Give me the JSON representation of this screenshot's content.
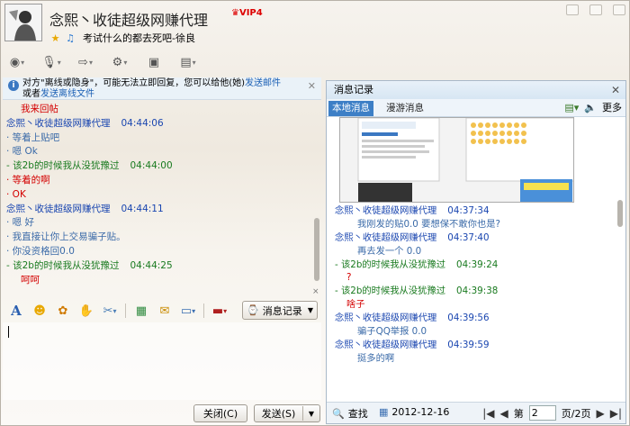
{
  "header": {
    "title": "念熙丶收徒超级网赚代理",
    "vip": "VIP4",
    "signature": "考试什么的都去死吧-徐良"
  },
  "notice": {
    "text": "对方\"离线或隐身\"，可能无法立即回复，您可以给他(她)",
    "link1": "发送邮件",
    "middle": "或者",
    "link2": "发送离线文件"
  },
  "chat": [
    {
      "text": "我来回帖",
      "style": "red",
      "indent": true
    },
    {
      "text": "念熙丶收徒超级网赚代理",
      "time": "04:44:06",
      "style": "blue"
    },
    {
      "text": "· 等着上贴吧",
      "style": "msg"
    },
    {
      "text": "· 嗯 Ok",
      "style": "msg"
    },
    {
      "text": "- 该2b的时候我从没犹豫过",
      "time": "04:44:00",
      "style": "green"
    },
    {
      "text": "· 等着的啊",
      "style": "red"
    },
    {
      "text": "· OK",
      "style": "red"
    },
    {
      "text": "念熙丶收徒超级网赚代理",
      "time": "04:44:11",
      "style": "blue"
    },
    {
      "text": "· 嗯 好",
      "style": "msg"
    },
    {
      "text": "· 我直接让你上交易骗子贴。",
      "style": "msg"
    },
    {
      "text": "·   你没资格回0.0",
      "style": "msg"
    },
    {
      "text": "- 该2b的时候我从没犹豫过",
      "time": "04:44:25",
      "style": "green"
    },
    {
      "text": "呵呵",
      "style": "red",
      "indent": true
    }
  ],
  "buttons": {
    "message_record": "消息记录",
    "close": "关闭(C)",
    "send": "发送(S)"
  },
  "history": {
    "title": "消息记录",
    "tab_local": "本地消息",
    "tab_roam": "漫游消息",
    "more": "更多",
    "lines": [
      {
        "text": "念熙丶收徒超级网赚代理",
        "time": "04:37:34",
        "style": "blue"
      },
      {
        "text": "我刚发的贴0.0  要想保不敢你也是?",
        "style": "msg"
      },
      {
        "text": "念熙丶收徒超级网赚代理",
        "time": "04:37:40",
        "style": "blue"
      },
      {
        "text": "再去发一个  0.0",
        "style": "msg"
      },
      {
        "text": "- 该2b的时候我从没犹豫过",
        "time": "04:39:24",
        "style": "green"
      },
      {
        "text": "?",
        "style": "red"
      },
      {
        "text": "- 该2b的时候我从没犹豫过",
        "time": "04:39:38",
        "style": "green"
      },
      {
        "text": "啥子",
        "style": "red"
      },
      {
        "text": "念熙丶收徒超级网赚代理",
        "time": "04:39:56",
        "style": "blue"
      },
      {
        "text": "骗子QQ举报 0.0",
        "style": "msg"
      },
      {
        "text": "念熙丶收徒超级网赚代理",
        "time": "04:39:59",
        "style": "blue"
      },
      {
        "text": "挺多的啊",
        "style": "msg"
      }
    ],
    "find": "查找",
    "date": "2012-12-16",
    "page_label": "第",
    "page": "2",
    "page_total": "页/2页"
  }
}
